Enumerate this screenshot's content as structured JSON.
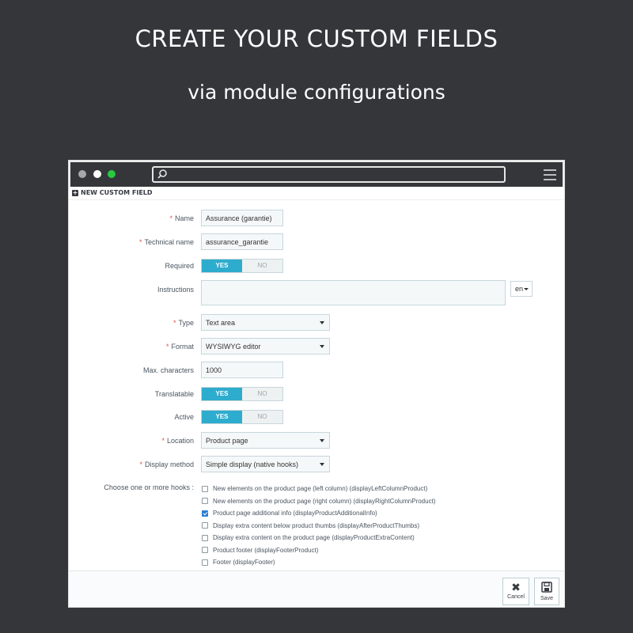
{
  "banner": {
    "title": "CREATE YOUR CUSTOM FIELDS",
    "subtitle": "via module configurations"
  },
  "window": {
    "panel_heading": "NEW CUSTOM FIELD"
  },
  "form": {
    "name": {
      "label": "Name",
      "value": "Assurance (garantie)"
    },
    "technical_name": {
      "label": "Technical name",
      "value": "assurance_garantie"
    },
    "required": {
      "label": "Required",
      "yes": "YES",
      "no": "NO"
    },
    "instructions": {
      "label": "Instructions",
      "lang": "en"
    },
    "type": {
      "label": "Type",
      "value": "Text area"
    },
    "format": {
      "label": "Format",
      "value": "WYSIWYG editor"
    },
    "max_characters": {
      "label": "Max. characters",
      "value": "1000"
    },
    "translatable": {
      "label": "Translatable",
      "yes": "YES",
      "no": "NO"
    },
    "active": {
      "label": "Active",
      "yes": "YES",
      "no": "NO"
    },
    "location": {
      "label": "Location",
      "value": "Product page"
    },
    "display_method": {
      "label": "Display method",
      "value": "Simple display (native hooks)"
    },
    "hooks_label": "Choose one or more hooks :",
    "hooks": [
      {
        "label": "New elements on the product page (left column) (displayLeftColumnProduct)",
        "checked": false
      },
      {
        "label": "New elements on the product page (right column) (displayRightColumnProduct)",
        "checked": false
      },
      {
        "label": "Product page additional info (displayProductAdditionalInfo)",
        "checked": true
      },
      {
        "label": "Display extra content below product thumbs (displayAfterProductThumbs)",
        "checked": false
      },
      {
        "label": "Display extra content on the product page (displayProductExtraContent)",
        "checked": false
      },
      {
        "label": "Product footer (displayFooterProduct)",
        "checked": false
      },
      {
        "label": "Footer (displayFooter)",
        "checked": false
      }
    ]
  },
  "footer": {
    "cancel_label": "Cancel",
    "save_label": "Save"
  },
  "colors": {
    "background": "#34363a",
    "toggle_on": "#2eacce",
    "required_star": "#e34d4d",
    "checkbox_checked": "#2e7fd6",
    "traffic_green": "#28c940"
  }
}
